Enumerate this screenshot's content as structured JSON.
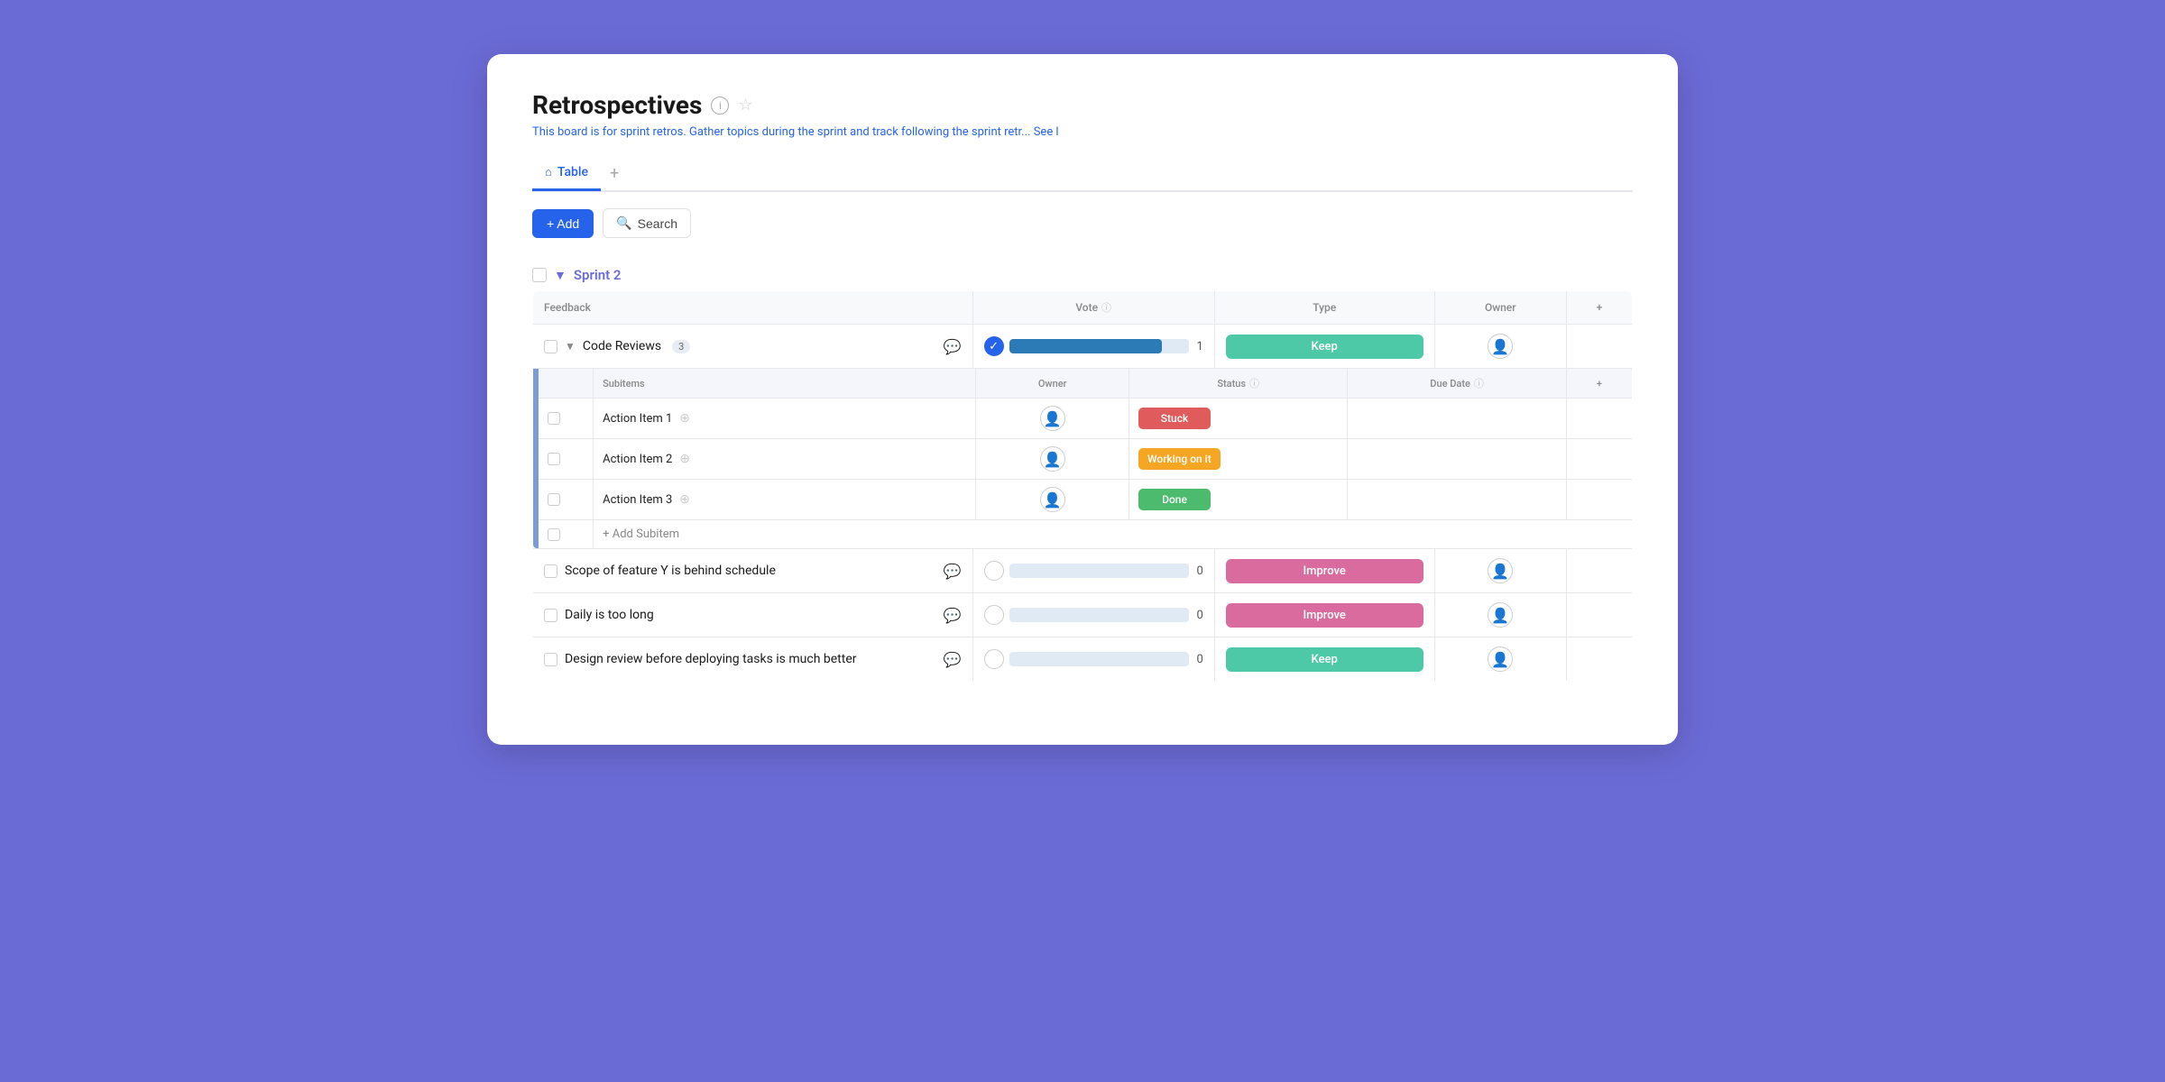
{
  "page": {
    "title": "Retrospectives",
    "subtitle": "This board is for sprint retros. Gather topics during the sprint and track following the sprint retr...",
    "see_more": "See l",
    "tabs": [
      {
        "label": "Table",
        "active": true
      }
    ],
    "tab_add": "+",
    "toolbar": {
      "add_label": "+ Add",
      "search_label": "Search"
    }
  },
  "group": {
    "title": "Sprint 2",
    "table_headers": {
      "feedback": "Feedback",
      "vote": "Vote",
      "type": "Type",
      "owner": "Owner",
      "plus": "+"
    },
    "rows": [
      {
        "id": "code-reviews",
        "name": "Code Reviews",
        "count": 3,
        "vote_filled": true,
        "vote_bar_pct": 85,
        "vote_num": 1,
        "type": "Keep",
        "type_class": "type-keep",
        "has_subitems": true
      },
      {
        "id": "scope-feature",
        "name": "Scope of feature Y is behind schedule",
        "count": null,
        "vote_filled": false,
        "vote_bar_pct": 0,
        "vote_num": 0,
        "type": "Improve",
        "type_class": "type-improve",
        "has_subitems": false
      },
      {
        "id": "daily-too-long",
        "name": "Daily is too long",
        "count": null,
        "vote_filled": false,
        "vote_bar_pct": 0,
        "vote_num": 0,
        "type": "Improve",
        "type_class": "type-improve",
        "has_subitems": false
      },
      {
        "id": "design-review",
        "name": "Design review before deploying tasks is much better",
        "count": null,
        "vote_filled": false,
        "vote_bar_pct": 0,
        "vote_num": 0,
        "type": "Keep",
        "type_class": "type-keep",
        "has_subitems": false
      }
    ],
    "subitems": {
      "headers": {
        "subitems": "Subitems",
        "owner": "Owner",
        "status": "Status",
        "due_date": "Due Date",
        "plus": "+"
      },
      "rows": [
        {
          "name": "Action Item 1",
          "status": "Stuck",
          "status_class": "status-stuck"
        },
        {
          "name": "Action Item 2",
          "status": "Working on it",
          "status_class": "status-working"
        },
        {
          "name": "Action Item 3",
          "status": "Done",
          "status_class": "status-done"
        }
      ],
      "add_label": "+ Add Subitem"
    }
  }
}
